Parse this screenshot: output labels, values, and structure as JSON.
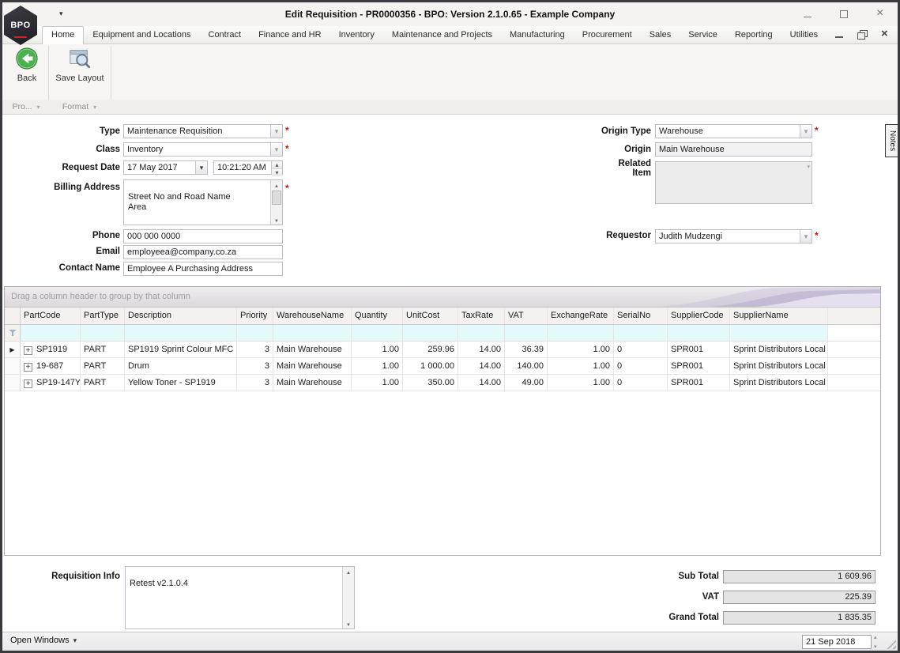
{
  "window": {
    "title": "Edit Requisition - PR0000356 - BPO: Version 2.1.0.65 - Example Company",
    "logo_text": "BPO"
  },
  "icons": {
    "expand": "+",
    "row_arrow": "▶"
  },
  "ribbon": {
    "tabs": [
      "Home",
      "Equipment and Locations",
      "Contract",
      "Finance and HR",
      "Inventory",
      "Maintenance and Projects",
      "Manufacturing",
      "Procurement",
      "Sales",
      "Service",
      "Reporting",
      "Utilities"
    ],
    "active_tab": "Home",
    "buttons": [
      {
        "label": "Back"
      },
      {
        "label": "Save Layout"
      }
    ],
    "group_captions": [
      "Pro...",
      "Format"
    ]
  },
  "form": {
    "required_marker": "*",
    "notes_tab": "Notes",
    "fields": {
      "type": {
        "label": "Type",
        "value": "Maintenance Requisition"
      },
      "class": {
        "label": "Class",
        "value": "Inventory"
      },
      "request_date": {
        "label": "Request Date",
        "date": "17 May 2017",
        "time": "10:21:20 AM"
      },
      "billing_address": {
        "label": "Billing Address",
        "value": "Street No and Road Name\nArea"
      },
      "phone": {
        "label": "Phone",
        "value": "000 000 0000"
      },
      "email": {
        "label": "Email",
        "value": "employeea@company.co.za"
      },
      "contact_name": {
        "label": "Contact Name",
        "value": "Employee A Purchasing Address"
      },
      "origin_type": {
        "label": "Origin Type",
        "value": "Warehouse"
      },
      "origin": {
        "label": "Origin",
        "value": "Main Warehouse"
      },
      "related_item": {
        "label": "Related Item",
        "value": ""
      },
      "requestor": {
        "label": "Requestor",
        "value": "Judith Mudzengi"
      }
    }
  },
  "grid": {
    "group_hint": "Drag a column header to group by that column",
    "columns": [
      "PartCode",
      "PartType",
      "Description",
      "Priority",
      "WarehouseName",
      "Quantity",
      "UnitCost",
      "TaxRate",
      "VAT",
      "ExchangeRate",
      "SerialNo",
      "SupplierCode",
      "SupplierName"
    ],
    "rows": [
      [
        "SP1919",
        "PART",
        "SP1919 Sprint Colour MFC",
        "3",
        "Main Warehouse",
        "1.00",
        "259.96",
        "14.00",
        "36.39",
        "1.00",
        "0",
        "SPR001",
        "Sprint Distributors Local"
      ],
      [
        "19-687",
        "PART",
        "Drum",
        "3",
        "Main Warehouse",
        "1.00",
        "1 000.00",
        "14.00",
        "140.00",
        "1.00",
        "0",
        "SPR001",
        "Sprint Distributors Local"
      ],
      [
        "SP19-147Y",
        "PART",
        "Yellow Toner - SP1919",
        "3",
        "Main Warehouse",
        "1.00",
        "350.00",
        "14.00",
        "49.00",
        "1.00",
        "0",
        "SPR001",
        "Sprint Distributors Local"
      ]
    ],
    "focused_row": 0
  },
  "footer": {
    "requisition_info": {
      "label": "Requisition Info",
      "value": "Retest v2.1.0.4"
    },
    "totals": [
      {
        "label": "Sub Total",
        "value": "1 609.96"
      },
      {
        "label": "VAT",
        "value": "225.39"
      },
      {
        "label": "Grand Total",
        "value": "1 835.35"
      }
    ]
  },
  "statusbar": {
    "open_windows_label": "Open Windows",
    "date_value": "21 Sep 2018"
  }
}
